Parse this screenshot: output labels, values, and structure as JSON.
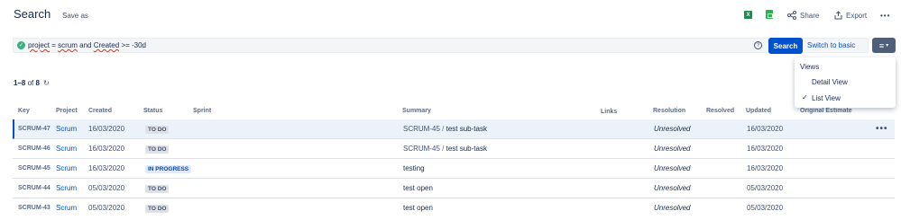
{
  "header": {
    "title": "Search",
    "save_as": "Save as",
    "share": "Share",
    "export": "Export",
    "more": "•••",
    "xls_icon": "X"
  },
  "search": {
    "query_part1": "project",
    "query_part2": " = ",
    "query_part3": "scrum",
    "query_part4": " and ",
    "query_part5": "Created",
    "query_part6": " >= -30d",
    "help": "?",
    "search_button": "Search",
    "switch_basic": "Switch to basic"
  },
  "results": {
    "range": "1–8",
    "of_label": " of ",
    "total": "8"
  },
  "views_menu": {
    "heading": "Views",
    "items": [
      "Detail View",
      "List View"
    ],
    "selected": "List View"
  },
  "columns": [
    "Key",
    "Project",
    "Created",
    "Status",
    "Sprint",
    "Summary",
    "Links",
    "Resolution",
    "Resolved",
    "Updated",
    "Original Estimate"
  ],
  "rows": [
    {
      "key": "SCRUM-47",
      "project": "Scrum",
      "created": "16/03/2020",
      "status": "TO DO",
      "summary_parent": "SCRUM-45",
      "summary_sep": "/",
      "summary": "test sub-task",
      "resolution": "Unresolved",
      "updated": "16/03/2020"
    },
    {
      "key": "SCRUM-46",
      "project": "Scrum",
      "created": "16/03/2020",
      "status": "TO DO",
      "summary_parent": "SCRUM-45",
      "summary_sep": "/",
      "summary": "test sub-task",
      "resolution": "Unresolved",
      "updated": "16/03/2020"
    },
    {
      "key": "SCRUM-45",
      "project": "Scrum",
      "created": "16/03/2020",
      "status": "IN PROGRESS",
      "summary_parent": "",
      "summary_sep": "",
      "summary": "testing",
      "resolution": "Unresolved",
      "updated": "16/03/2020"
    },
    {
      "key": "SCRUM-44",
      "project": "Scrum",
      "created": "05/03/2020",
      "status": "TO DO",
      "summary_parent": "",
      "summary_sep": "",
      "summary": "test open",
      "resolution": "Unresolved",
      "updated": "05/03/2020"
    },
    {
      "key": "SCRUM-43",
      "project": "Scrum",
      "created": "05/03/2020",
      "status": "TO DO",
      "summary_parent": "",
      "summary_sep": "",
      "summary": "test open",
      "resolution": "Unresolved",
      "updated": "05/03/2020"
    }
  ],
  "row_more": "•••",
  "colors": {
    "accent": "#0052cc",
    "success": "#36b37e",
    "selected_row": "#ebf2fa"
  }
}
